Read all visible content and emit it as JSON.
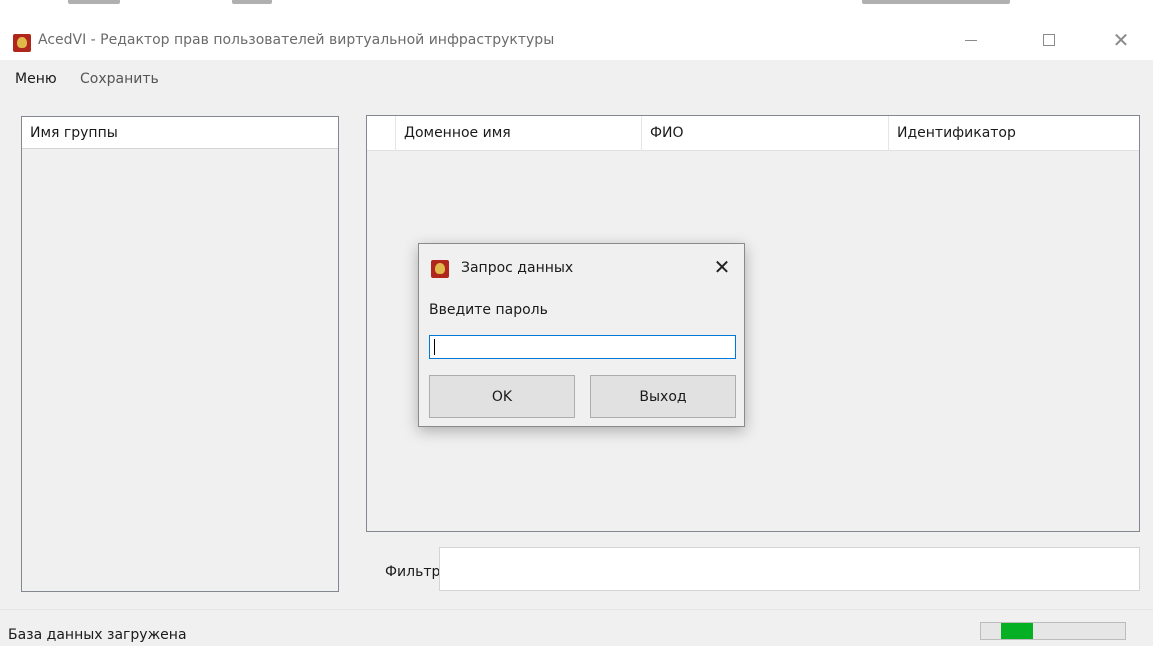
{
  "window": {
    "title": "AcedVI - Редактор прав пользователей виртуальной инфраструктуры",
    "icon": "app-logo-icon"
  },
  "menubar": {
    "items": [
      {
        "label": "Меню"
      },
      {
        "label": "Сохранить"
      }
    ]
  },
  "groups": {
    "header": "Имя группы",
    "items": []
  },
  "users": {
    "columns": [
      "",
      "Доменное имя",
      "ФИО",
      "Идентификатор"
    ],
    "rows": []
  },
  "filter": {
    "label": "Фильтр",
    "value": ""
  },
  "status": {
    "text": "База данных загружена",
    "progress": {
      "fill_start": 0.14,
      "fill_end": 0.36,
      "color": "#06b025"
    }
  },
  "dialog": {
    "title": "Запрос данных",
    "prompt": "Введите пароль",
    "value": "",
    "ok_label": "OK",
    "exit_label": "Выход"
  },
  "colors": {
    "window_bg": "#f0f0f0",
    "focus_border": "#0078d7",
    "progress_green": "#06b025"
  }
}
